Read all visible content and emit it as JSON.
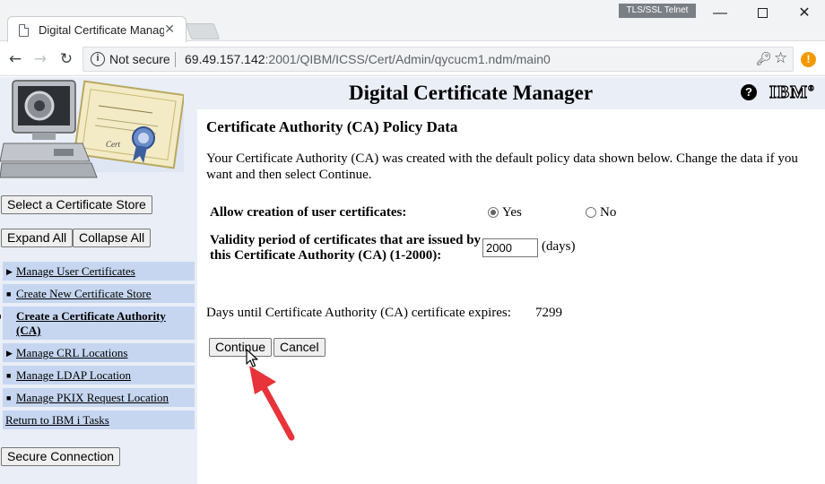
{
  "browser": {
    "tab_title": "Digital Certificate Manag",
    "tab_close": "✕",
    "extension_badge": "TLS/SSL Telnet",
    "security_label": "Not secure",
    "url_host": "69.49.157.142",
    "url_rest": ":2001/QIBM/ICSS/Cert/Admin/qycucm1.ndm/main0",
    "alert": "!"
  },
  "header": {
    "title": "Digital Certificate Manager",
    "help": "?",
    "ibm_logo": "IBM",
    "ibm_mark": "®"
  },
  "sidebar": {
    "select_store_label": "Select a Certificate Store",
    "expand_all_label": "Expand All",
    "collapse_all_label": "Collapse All",
    "items": [
      {
        "label": "Manage User Certificates",
        "marker": "▶"
      },
      {
        "label": "Create New Certificate Store",
        "marker": "■"
      },
      {
        "label": "Create a Certificate Authority (CA)",
        "marker": "■",
        "selected": true
      },
      {
        "label": "Manage CRL Locations",
        "marker": "▶"
      },
      {
        "label": "Manage LDAP Location",
        "marker": "■"
      },
      {
        "label": "Manage PKIX Request Location",
        "marker": "■"
      },
      {
        "label": "Return to IBM i Tasks",
        "marker": ""
      }
    ],
    "secure_connection_label": "Secure Connection"
  },
  "main": {
    "section_title": "Certificate Authority (CA) Policy Data",
    "intro": "Your Certificate Authority (CA) was created with the default policy data shown below. Change the data if you want and then select Continue.",
    "allow_label": "Allow creation of user certificates:",
    "radio_yes": "Yes",
    "radio_no": "No",
    "allow_selected": "Yes",
    "validity_label": "Validity period of certificates that are issued by this Certificate Authority (CA) (1-2000):",
    "validity_value": "2000",
    "validity_unit": "(days)",
    "expiry_label": "Days until Certificate Authority (CA) certificate expires:",
    "expiry_value": "7299",
    "continue_label": "Continue",
    "cancel_label": "Cancel"
  },
  "colors": {
    "sidebar_bg": "#e9eef7",
    "nav_item_bg": "#c6d6f0",
    "annotation_arrow": "#e8333a"
  }
}
